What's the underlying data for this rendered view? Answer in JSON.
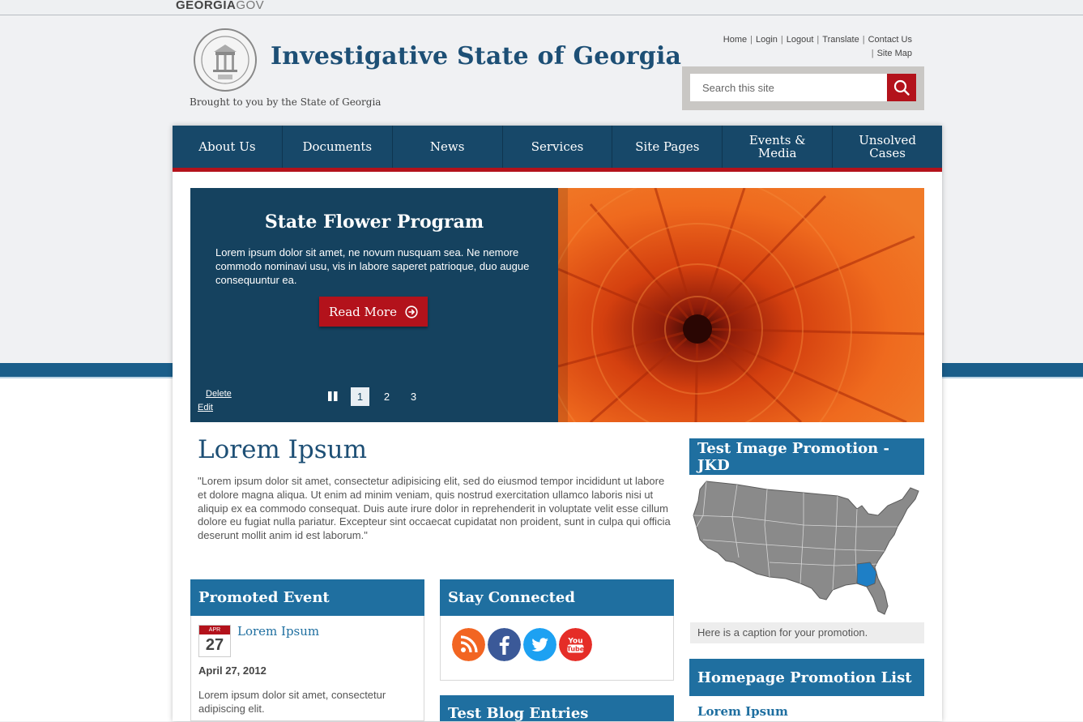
{
  "topbar": {
    "brand_bold": "GEORGIA",
    "brand_light": "GOV"
  },
  "header": {
    "title": "Investigative State of Georgia",
    "tagline": "Brought to you by the State of Georgia",
    "utility_links": [
      "Home",
      "Login",
      "Logout",
      "Translate",
      "Contact Us",
      "Site Map"
    ],
    "search_placeholder": "Search this site"
  },
  "nav": {
    "items": [
      "About Us",
      "Documents",
      "News",
      "Services",
      "Site Pages",
      "Events &\nMedia",
      "Unsolved\nCases"
    ]
  },
  "hero": {
    "title": "State Flower Program",
    "text": "Lorem ipsum dolor sit amet, ne novum nusquam sea. Ne nemore commodo nominavi usu, vis in labore saperet patrioque, duo augue consequuntur ea.",
    "button": "Read More",
    "delete_label": "Delete",
    "edit_label": "Edit",
    "pages": [
      "1",
      "2",
      "3"
    ],
    "active_page": "1"
  },
  "main": {
    "title": "Lorem Ipsum",
    "text": "\"Lorem ipsum dolor sit amet, consectetur adipisicing elit, sed do eiusmod tempor incididunt ut labore et dolore magna aliqua. Ut enim ad minim veniam, quis nostrud exercitation ullamco laboris nisi ut aliquip ex ea commodo consequat. Duis aute irure dolor in reprehenderit in voluptate velit esse cillum dolore eu fugiat nulla pariatur. Excepteur sint occaecat cupidatat non proident, sunt in culpa qui officia deserunt mollit anim id est laborum.\""
  },
  "promoted_event": {
    "heading": "Promoted Event",
    "cal_month": "APR",
    "cal_day": "27",
    "title": "Lorem Ipsum",
    "date": "April 27, 2012",
    "desc": "Lorem ipsum dolor sit amet, consectetur adipiscing elit."
  },
  "stay_connected": {
    "heading": "Stay Connected",
    "icons": [
      "rss-icon",
      "facebook-icon",
      "twitter-icon",
      "youtube-icon"
    ],
    "youtube_text_1": "You",
    "youtube_text_2": "Tube"
  },
  "blog": {
    "heading": "Test Blog Entries"
  },
  "promotion": {
    "heading": "Test Image Promotion - JKD",
    "caption": "Here is a caption for your promotion."
  },
  "promo_list": {
    "heading": "Homepage Promotion List",
    "first_item": "Lorem Ipsum"
  },
  "colors": {
    "nav_bg": "#174869",
    "accent_red": "#b3121b",
    "box_header": "#1f6fa0",
    "hero_bg": "#15425f",
    "map_highlight": "#1e7fc6"
  }
}
